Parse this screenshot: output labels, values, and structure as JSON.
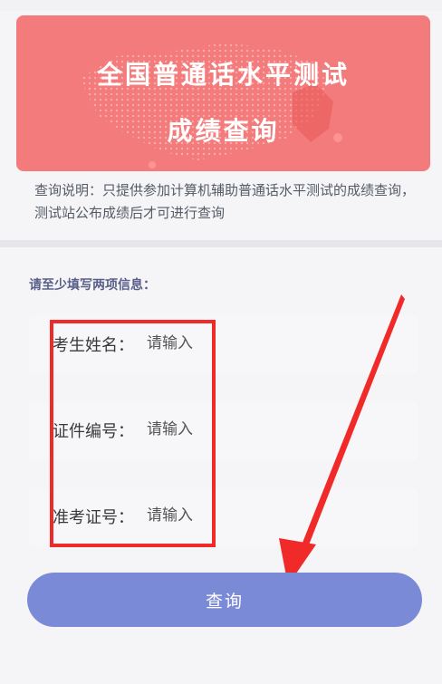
{
  "banner": {
    "title": "全国普通话水平测试",
    "subtitle": "成绩查询"
  },
  "note": "查询说明：只提供参加计算机辅助普通话水平测试的成绩查询，测试站公布成绩后才可进行查询",
  "form": {
    "hint": "请至少填写两项信息：",
    "fields": [
      {
        "label": "考生姓名：",
        "placeholder": "请输入"
      },
      {
        "label": "证件编号：",
        "placeholder": "请输入"
      },
      {
        "label": "准考证号：",
        "placeholder": "请输入"
      }
    ],
    "submit_label": "查询"
  },
  "colors": {
    "banner": "#f47b7b",
    "button": "#7b8ad6",
    "annotation": "#f02929"
  }
}
